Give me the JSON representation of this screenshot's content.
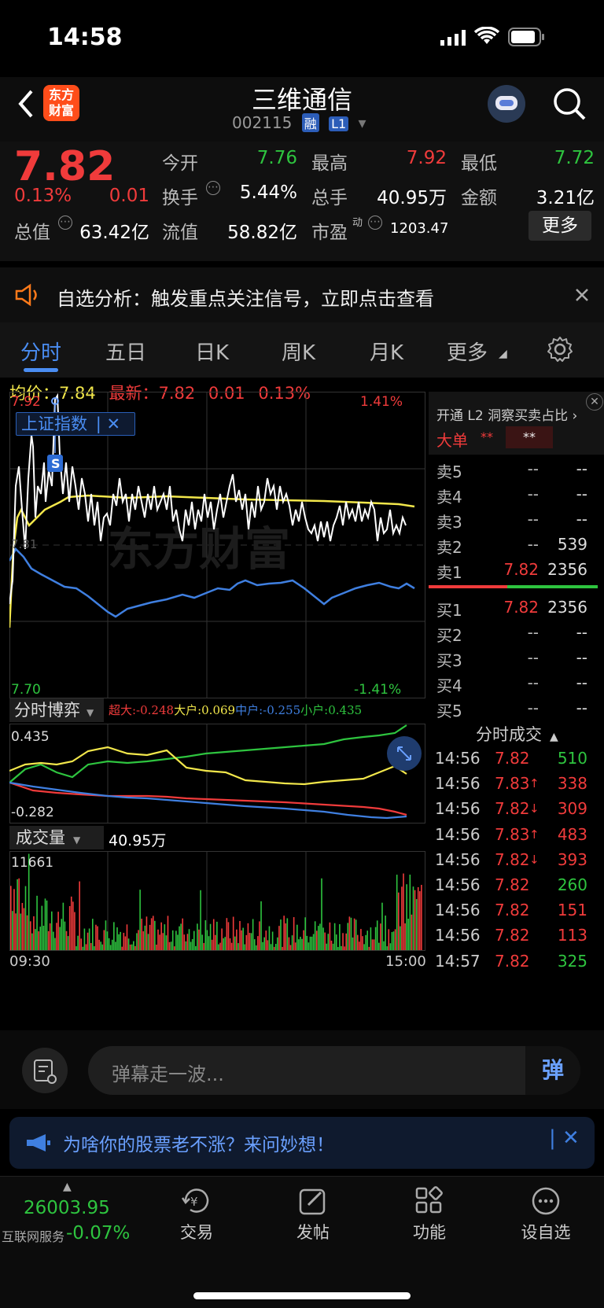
{
  "status": {
    "time": "14:58"
  },
  "header": {
    "title": "三维通信",
    "code": "002115",
    "tag1": "融",
    "tag2": "L1",
    "logo": "东方\n财富"
  },
  "quote": {
    "price": "7.82",
    "pct": "0.13%",
    "chg": "0.01",
    "open_k": "今开",
    "open_v": "7.76",
    "high_k": "最高",
    "high_v": "7.92",
    "low_k": "最低",
    "low_v": "7.72",
    "turn_k": "换手",
    "turn_v": "5.44%",
    "vol_k": "总手",
    "vol_v": "40.95万",
    "amt_k": "金额",
    "amt_v": "3.21亿",
    "mcap_k": "总值",
    "mcap_v": "63.42亿",
    "flt_k": "流值",
    "flt_v": "58.82亿",
    "pe_k": "市盈",
    "pe_sup": "动",
    "pe_v": "1203.47",
    "more": "更多"
  },
  "notice": {
    "text": "自选分析：触发重点关注信号，立即点击查看"
  },
  "tabs": [
    "分时",
    "五日",
    "日K",
    "周K",
    "月K",
    "更多"
  ],
  "chart": {
    "avg_label": "均价：",
    "avg": "7.84",
    "latest_label": "最新：",
    "latest": "7.82",
    "chg": "0.01",
    "pct": "0.13%",
    "y_high": "7.92",
    "y_low": "7.70",
    "pct_high": "1.41%",
    "pct_low": "-1.41%",
    "mid_label": "7.81",
    "index_tag": "上证指数",
    "s_marker": "S",
    "watermark": "东方财富",
    "game_title": "分时博弈",
    "game_sup": "超大:-0.248",
    "game_big": "大户:0.069",
    "game_mid": "中户:-0.255",
    "game_small": "小户:0.435",
    "game_max": "0.435",
    "game_min": "-0.282",
    "vol_title": "成交量",
    "vol_total": "40.95万",
    "vol_max": "11661",
    "t_start": "09:30",
    "t_end": "15:00"
  },
  "orderbook": {
    "promo": "开通 L2 洞察买卖占比",
    "big": "大单",
    "big_v1": "**",
    "big_v2": "**",
    "sells": [
      {
        "k": "卖5",
        "p": "--",
        "v": "--"
      },
      {
        "k": "卖4",
        "p": "--",
        "v": "--"
      },
      {
        "k": "卖3",
        "p": "--",
        "v": "--"
      },
      {
        "k": "卖2",
        "p": "--",
        "v": "539"
      },
      {
        "k": "卖1",
        "p": "7.82",
        "v": "2356"
      }
    ],
    "buys": [
      {
        "k": "买1",
        "p": "7.82",
        "v": "2356"
      },
      {
        "k": "买2",
        "p": "--",
        "v": "--"
      },
      {
        "k": "买3",
        "p": "--",
        "v": "--"
      },
      {
        "k": "买4",
        "p": "--",
        "v": "--"
      },
      {
        "k": "买5",
        "p": "--",
        "v": "--"
      }
    ],
    "trades_title": "分时成交",
    "trades": [
      {
        "t": "14:56",
        "p": "7.82",
        "a": "",
        "v": "510"
      },
      {
        "t": "14:56",
        "p": "7.83",
        "a": "↑",
        "v": "338"
      },
      {
        "t": "14:56",
        "p": "7.82",
        "a": "↓",
        "v": "309"
      },
      {
        "t": "14:56",
        "p": "7.83",
        "a": "↑",
        "v": "483"
      },
      {
        "t": "14:56",
        "p": "7.82",
        "a": "↓",
        "v": "393"
      },
      {
        "t": "14:56",
        "p": "7.82",
        "a": "",
        "v": "260"
      },
      {
        "t": "14:56",
        "p": "7.82",
        "a": "",
        "v": "151"
      },
      {
        "t": "14:56",
        "p": "7.82",
        "a": "",
        "v": "113"
      },
      {
        "t": "14:57",
        "p": "7.82",
        "a": "",
        "v": "325"
      }
    ]
  },
  "comment": {
    "placeholder": "弹幕走一波...",
    "btn": "弹"
  },
  "ad": {
    "text": "为啥你的股票老不涨？来问妙想！"
  },
  "bottom": {
    "index_val": "26003.95",
    "index_name": "互联网服务",
    "index_pct": "-0.07%",
    "items": [
      "交易",
      "发帖",
      "功能",
      "设自选"
    ]
  }
}
